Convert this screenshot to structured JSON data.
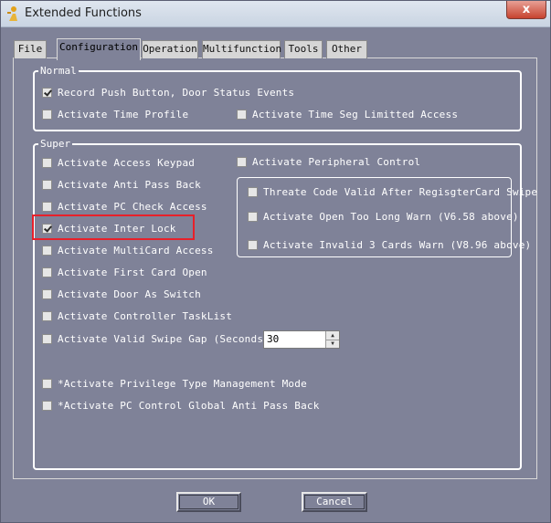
{
  "window": {
    "title": "Extended Functions",
    "close_label": "x",
    "app_icon": "key-person-icon"
  },
  "tabs": [
    {
      "label": "File",
      "active": false
    },
    {
      "label": "Configuration",
      "active": true
    },
    {
      "label": "Operation",
      "active": false
    },
    {
      "label": "Multifunction",
      "active": false
    },
    {
      "label": "Tools",
      "active": false
    },
    {
      "label": "Other",
      "active": false
    }
  ],
  "normal": {
    "label": "Normal",
    "items": [
      {
        "label": "Record Push Button, Door Status Events",
        "checked": true
      },
      {
        "label": "Activate Time Profile",
        "checked": false
      },
      {
        "label": "Activate Time Seg Limitted Access",
        "checked": false
      }
    ]
  },
  "super": {
    "label": "Super",
    "left_items": [
      {
        "label": "Activate Access Keypad",
        "checked": false
      },
      {
        "label": "Activate Anti Pass Back",
        "checked": false
      },
      {
        "label": "Activate PC Check Access",
        "checked": false
      },
      {
        "label": "Activate Inter Lock",
        "checked": true
      },
      {
        "label": "Activate MultiCard Access",
        "checked": false
      },
      {
        "label": "Activate First Card Open",
        "checked": false
      },
      {
        "label": "Activate Door As Switch",
        "checked": false
      },
      {
        "label": "Activate Controller TaskList",
        "checked": false
      },
      {
        "label": "Activate Valid Swipe Gap (Seconds)",
        "checked": false
      }
    ],
    "peripheral": {
      "label": "Activate Peripheral Control",
      "checked": false
    },
    "peripheral_items": [
      {
        "label": "Threate Code Valid After RegisgterCard Swipe",
        "checked": false
      },
      {
        "label": "Activate Open Too Long Warn (V6.58 above)",
        "checked": false
      },
      {
        "label": "Activate Invalid 3 Cards  Warn (V8.96 above)",
        "checked": false
      }
    ],
    "swipe_gap_value": "30",
    "bottom_items": [
      {
        "label": "*Activate Privilege Type Management Mode",
        "checked": false
      },
      {
        "label": "*Activate PC Control Global Anti Pass Back",
        "checked": false
      }
    ]
  },
  "buttons": {
    "ok": "OK",
    "cancel": "Cancel"
  },
  "colors": {
    "background": "#7f8298",
    "highlight": "#e8202a"
  }
}
